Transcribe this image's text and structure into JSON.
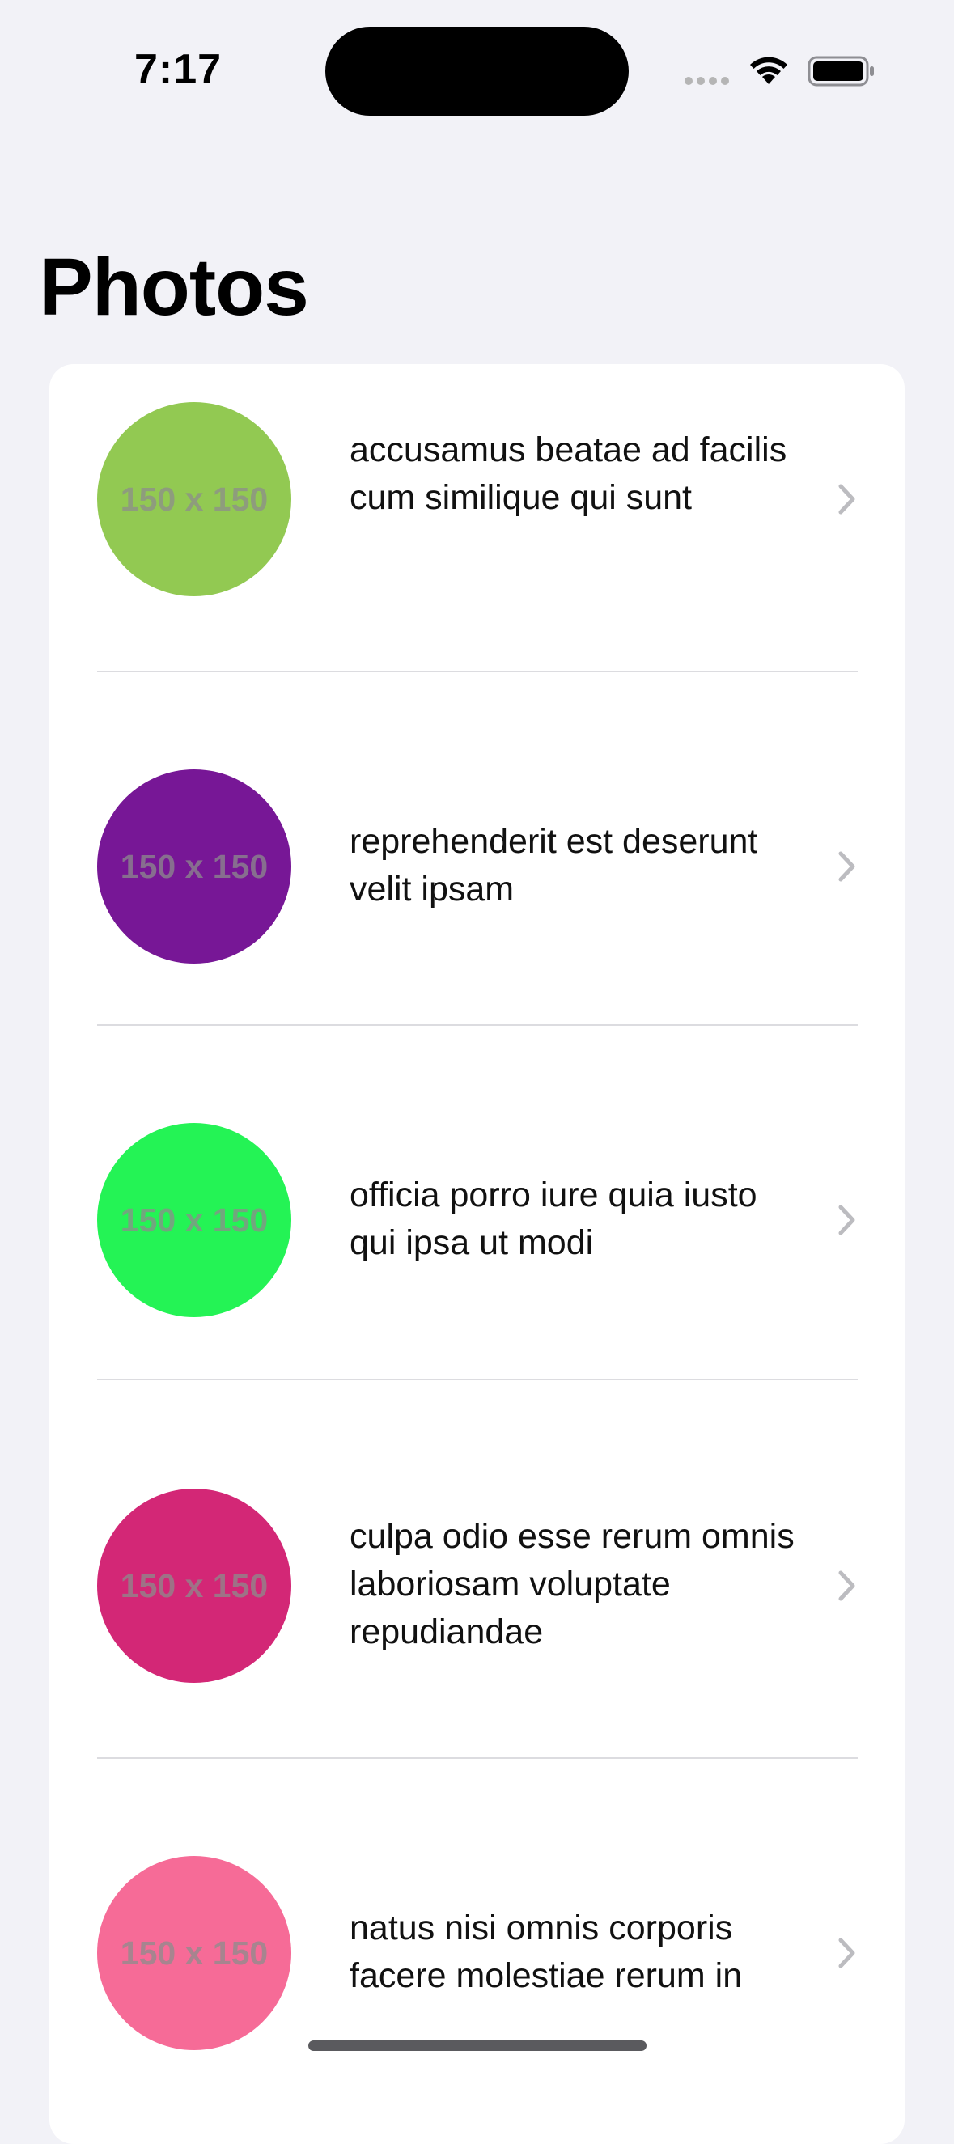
{
  "status_bar": {
    "time": "7:17"
  },
  "page": {
    "title": "Photos"
  },
  "photos": [
    {
      "title": "accusamus beatae ad facilis cum similique qui sunt",
      "thumbnail_text": "150 x 150",
      "color": "#92c952"
    },
    {
      "title": "reprehenderit est deserunt velit ipsam",
      "thumbnail_text": "150 x 150",
      "color": "#771796"
    },
    {
      "title": "officia porro iure quia iusto qui ipsa ut modi",
      "thumbnail_text": "150 x 150",
      "color": "#24f355"
    },
    {
      "title": "culpa odio esse rerum omnis laboriosam voluptate repudiandae",
      "thumbnail_text": "150 x 150",
      "color": "#d32776"
    },
    {
      "title": "natus nisi omnis corporis facere molestiae rerum in",
      "thumbnail_text": "150 x 150",
      "color": "#f66b97"
    }
  ]
}
